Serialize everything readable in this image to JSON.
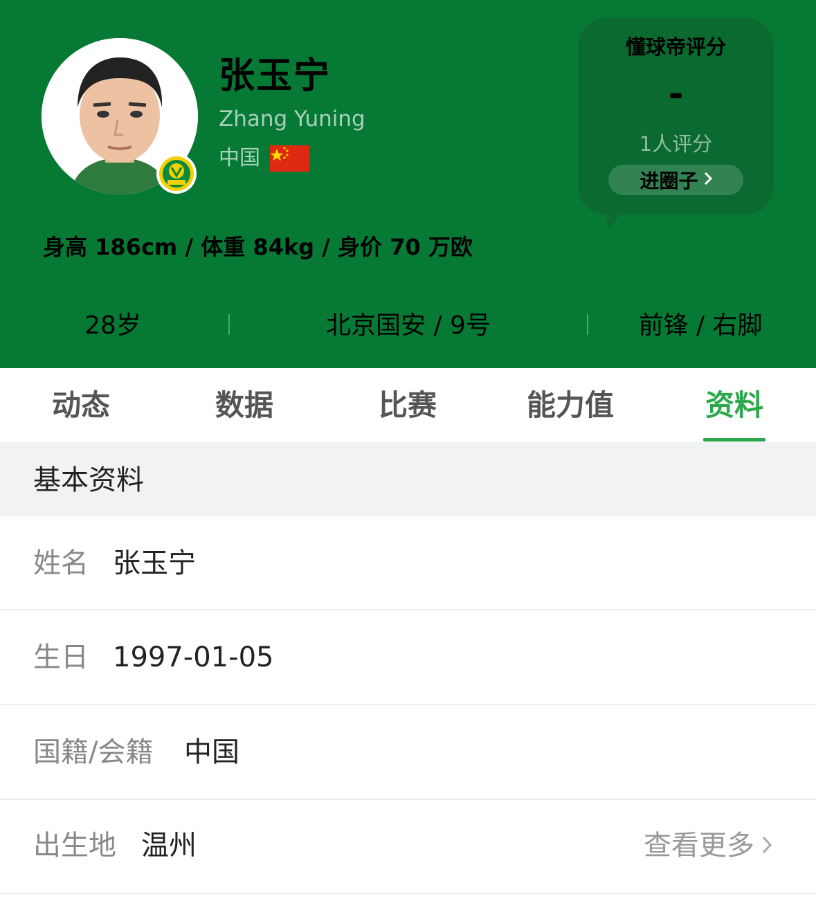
{
  "header": {
    "name_cn": "张玉宁",
    "name_en": "Zhang Yuning",
    "nationality": "中国",
    "stats_line": "身高 186cm / 体重 84kg / 身价 70 万欧",
    "age": "28岁",
    "club_number": "北京国安 / 9号",
    "position_foot": "前锋 / 右脚",
    "colors": {
      "brand_green": "#067a35",
      "accent_green": "#2aa84a"
    }
  },
  "rating": {
    "title": "懂球帝评分",
    "value": "-",
    "count": "1人评分",
    "button_label": "进圈子"
  },
  "tabs": [
    {
      "label": "动态"
    },
    {
      "label": "数据"
    },
    {
      "label": "比赛"
    },
    {
      "label": "能力值"
    },
    {
      "label": "资料",
      "active": true
    }
  ],
  "profile": {
    "section_title": "基本资料",
    "rows": [
      {
        "label": "姓名",
        "value": "张玉宁"
      },
      {
        "label": "生日",
        "value": "1997-01-05"
      },
      {
        "label": "国籍/会籍",
        "value": "中国"
      },
      {
        "label": "出生地",
        "value": "温州"
      }
    ],
    "more_label": "查看更多"
  },
  "icons": [
    "player-avatar",
    "club-badge-icon",
    "china-flag-icon",
    "chevron-right-icon"
  ]
}
